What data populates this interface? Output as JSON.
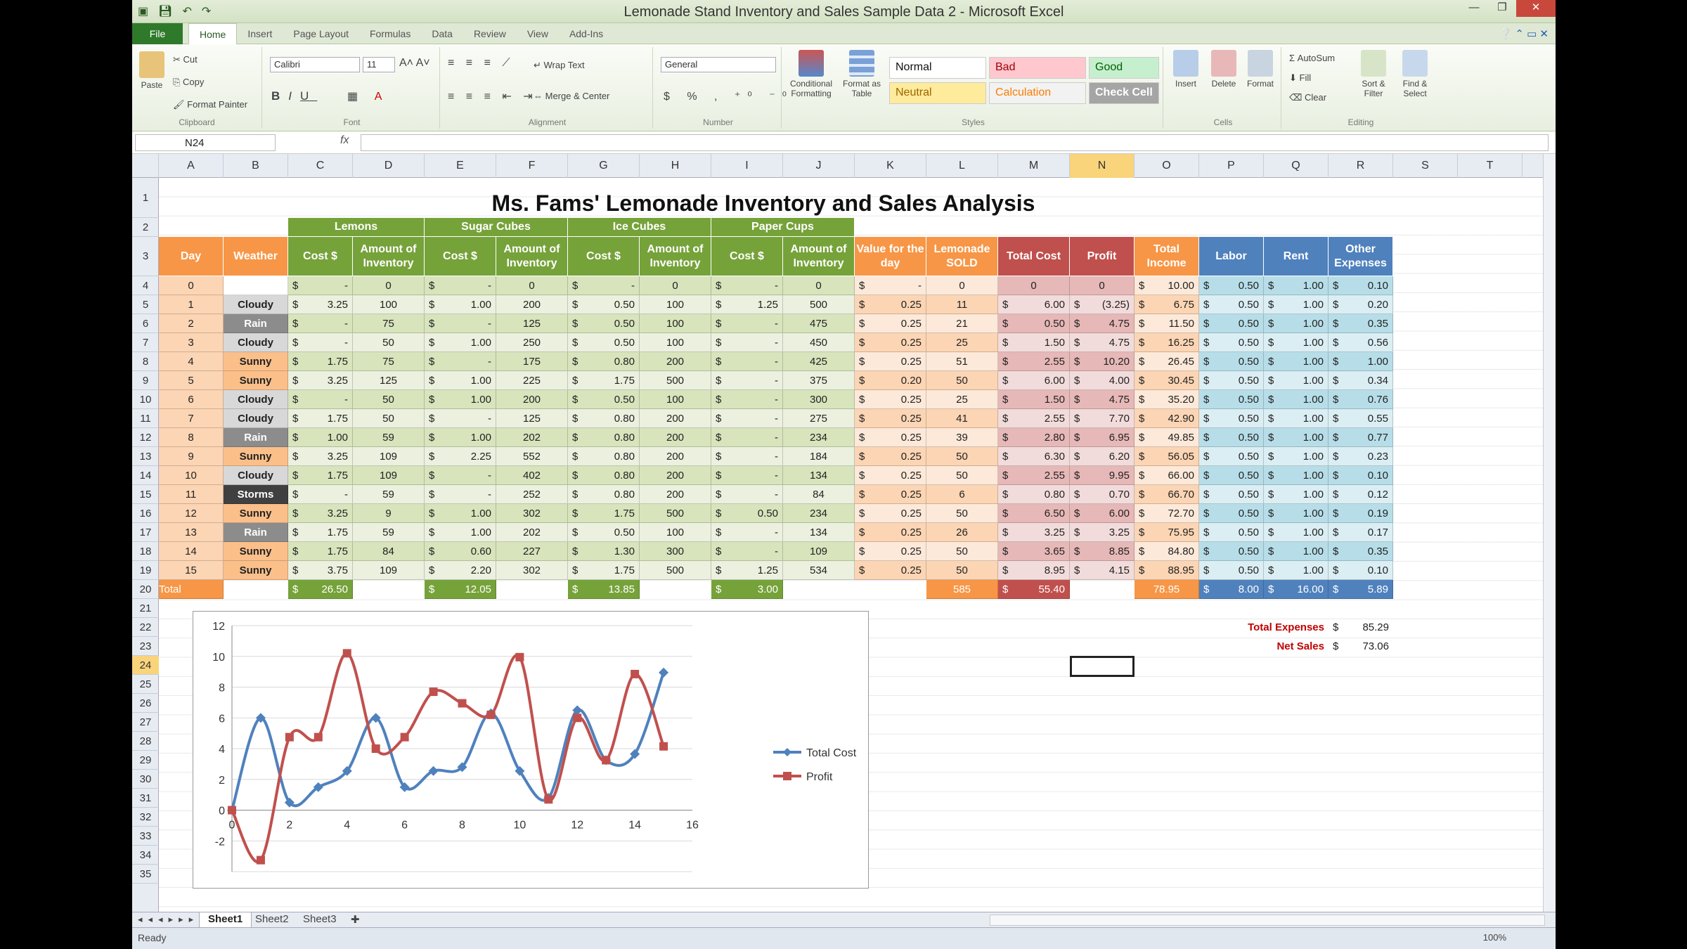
{
  "window": {
    "title": "Lemonade Stand Inventory and Sales Sample Data 2 - Microsoft Excel"
  },
  "tabs": {
    "file": "File",
    "items": [
      "Home",
      "Insert",
      "Page Layout",
      "Formulas",
      "Data",
      "Review",
      "View",
      "Add-Ins"
    ]
  },
  "ribbon": {
    "clipboard": {
      "paste": "Paste",
      "cut": "Cut",
      "copy": "Copy",
      "painter": "Format Painter",
      "label": "Clipboard"
    },
    "font": {
      "name": "Calibri",
      "size": "11",
      "label": "Font"
    },
    "alignment": {
      "wrap": "Wrap Text",
      "merge": "Merge & Center",
      "label": "Alignment"
    },
    "number": {
      "format": "General",
      "label": "Number"
    },
    "styles": {
      "conditional": "Conditional Formatting",
      "table": "Format as Table",
      "normal": "Normal",
      "bad": "Bad",
      "good": "Good",
      "neutral": "Neutral",
      "calculation": "Calculation",
      "check": "Check Cell",
      "label": "Styles"
    },
    "cells": {
      "insert": "Insert",
      "delete": "Delete",
      "format": "Format",
      "label": "Cells"
    },
    "editing": {
      "autosum": "AutoSum",
      "fill": "Fill",
      "clear": "Clear",
      "sort": "Sort & Filter",
      "find": "Find & Select",
      "label": "Editing"
    }
  },
  "formula": {
    "namebox": "N24",
    "fx": "fx"
  },
  "columns": [
    "A",
    "B",
    "C",
    "D",
    "E",
    "F",
    "G",
    "H",
    "I",
    "J",
    "K",
    "L",
    "M",
    "N",
    "O",
    "P",
    "Q",
    "R",
    "S",
    "T",
    "U"
  ],
  "rows": [
    "1",
    "2",
    "3",
    "4",
    "5",
    "6",
    "7",
    "8",
    "9",
    "10",
    "11",
    "12",
    "13",
    "14",
    "15",
    "16",
    "17",
    "18",
    "19",
    "20",
    "21",
    "22",
    "23",
    "24",
    "25",
    "26",
    "27",
    "28",
    "29",
    "30",
    "31",
    "32",
    "33",
    "34",
    "35"
  ],
  "report": {
    "title": "Ms. Fams' Lemonade Inventory and Sales Analysis Report",
    "groups": [
      "Lemons",
      "Sugar Cubes",
      "Ice Cubes",
      "Paper Cups"
    ],
    "headers": [
      "Day",
      "Weather",
      "Cost $",
      "Amount of Inventory",
      "Cost $",
      "Amount of Inventory",
      "Cost $",
      "Amount of Inventory",
      "Cost $",
      "Amount of Inventory",
      "Value for the day",
      "Lemonade SOLD",
      "Total Cost",
      "Profit",
      "Total Income",
      "Labor",
      "Rent",
      "Other Expenses"
    ],
    "rows": [
      [
        "0",
        "",
        "$ -",
        "0",
        "$ -",
        "0",
        "$ -",
        "0",
        "$ -",
        "0",
        "$ -",
        "0",
        "0",
        "0",
        "$ 10.00",
        "$ 0.50",
        "$ 1.00",
        "$ 0.10"
      ],
      [
        "1",
        "Cloudy",
        "$ 3.25",
        "100",
        "$ 1.00",
        "200",
        "$ 0.50",
        "100",
        "$ 1.25",
        "500",
        "$ 0.25",
        "11",
        "$ 6.00",
        "$ (3.25)",
        "$ 6.75",
        "$ 0.50",
        "$ 1.00",
        "$ 0.20"
      ],
      [
        "2",
        "Rain",
        "$ -",
        "75",
        "$ -",
        "125",
        "$ 0.50",
        "100",
        "$ -",
        "475",
        "$ 0.25",
        "21",
        "$ 0.50",
        "$ 4.75",
        "$ 11.50",
        "$ 0.50",
        "$ 1.00",
        "$ 0.35"
      ],
      [
        "3",
        "Cloudy",
        "$ -",
        "50",
        "$ 1.00",
        "250",
        "$ 0.50",
        "100",
        "$ -",
        "450",
        "$ 0.25",
        "25",
        "$ 1.50",
        "$ 4.75",
        "$ 16.25",
        "$ 0.50",
        "$ 1.00",
        "$ 0.56"
      ],
      [
        "4",
        "Sunny",
        "$ 1.75",
        "75",
        "$ -",
        "175",
        "$ 0.80",
        "200",
        "$ -",
        "425",
        "$ 0.25",
        "51",
        "$ 2.55",
        "$ 10.20",
        "$ 26.45",
        "$ 0.50",
        "$ 1.00",
        "$ 1.00"
      ],
      [
        "5",
        "Sunny",
        "$ 3.25",
        "125",
        "$ 1.00",
        "225",
        "$ 1.75",
        "500",
        "$ -",
        "375",
        "$ 0.20",
        "50",
        "$ 6.00",
        "$ 4.00",
        "$ 30.45",
        "$ 0.50",
        "$ 1.00",
        "$ 0.34"
      ],
      [
        "6",
        "Cloudy",
        "$ -",
        "50",
        "$ 1.00",
        "200",
        "$ 0.50",
        "100",
        "$ -",
        "300",
        "$ 0.25",
        "25",
        "$ 1.50",
        "$ 4.75",
        "$ 35.20",
        "$ 0.50",
        "$ 1.00",
        "$ 0.76"
      ],
      [
        "7",
        "Cloudy",
        "$ 1.75",
        "50",
        "$ -",
        "125",
        "$ 0.80",
        "200",
        "$ -",
        "275",
        "$ 0.25",
        "41",
        "$ 2.55",
        "$ 7.70",
        "$ 42.90",
        "$ 0.50",
        "$ 1.00",
        "$ 0.55"
      ],
      [
        "8",
        "Rain",
        "$ 1.00",
        "59",
        "$ 1.00",
        "202",
        "$ 0.80",
        "200",
        "$ -",
        "234",
        "$ 0.25",
        "39",
        "$ 2.80",
        "$ 6.95",
        "$ 49.85",
        "$ 0.50",
        "$ 1.00",
        "$ 0.77"
      ],
      [
        "9",
        "Sunny",
        "$ 3.25",
        "109",
        "$ 2.25",
        "552",
        "$ 0.80",
        "200",
        "$ -",
        "184",
        "$ 0.25",
        "50",
        "$ 6.30",
        "$ 6.20",
        "$ 56.05",
        "$ 0.50",
        "$ 1.00",
        "$ 0.23"
      ],
      [
        "10",
        "Cloudy",
        "$ 1.75",
        "109",
        "$ -",
        "402",
        "$ 0.80",
        "200",
        "$ -",
        "134",
        "$ 0.25",
        "50",
        "$ 2.55",
        "$ 9.95",
        "$ 66.00",
        "$ 0.50",
        "$ 1.00",
        "$ 0.10"
      ],
      [
        "11",
        "Storms",
        "$ -",
        "59",
        "$ -",
        "252",
        "$ 0.80",
        "200",
        "$ -",
        "84",
        "$ 0.25",
        "6",
        "$ 0.80",
        "$ 0.70",
        "$ 66.70",
        "$ 0.50",
        "$ 1.00",
        "$ 0.12"
      ],
      [
        "12",
        "Sunny",
        "$ 3.25",
        "9",
        "$ 1.00",
        "302",
        "$ 1.75",
        "500",
        "$ 0.50",
        "234",
        "$ 0.25",
        "50",
        "$ 6.50",
        "$ 6.00",
        "$ 72.70",
        "$ 0.50",
        "$ 1.00",
        "$ 0.19"
      ],
      [
        "13",
        "Rain",
        "$ 1.75",
        "59",
        "$ 1.00",
        "202",
        "$ 0.50",
        "100",
        "$ -",
        "134",
        "$ 0.25",
        "26",
        "$ 3.25",
        "$ 3.25",
        "$ 75.95",
        "$ 0.50",
        "$ 1.00",
        "$ 0.17"
      ],
      [
        "14",
        "Sunny",
        "$ 1.75",
        "84",
        "$ 0.60",
        "227",
        "$ 1.30",
        "300",
        "$ -",
        "109",
        "$ 0.25",
        "50",
        "$ 3.65",
        "$ 8.85",
        "$ 84.80",
        "$ 0.50",
        "$ 1.00",
        "$ 0.35"
      ],
      [
        "15",
        "Sunny",
        "$ 3.75",
        "109",
        "$ 2.20",
        "302",
        "$ 1.75",
        "500",
        "$ 1.25",
        "534",
        "$ 0.25",
        "50",
        "$ 8.95",
        "$ 4.15",
        "$ 88.95",
        "$ 0.50",
        "$ 1.00",
        "$ 0.10"
      ]
    ],
    "totals": {
      "label": "Total",
      "lemons": "$ 26.50",
      "sugar": "$ 12.05",
      "ice": "$ 13.85",
      "cups": "$ 3.00",
      "sold": "585",
      "cost": "$ 55.40",
      "income": "78.95",
      "labor": "$ 8.00",
      "rent": "$ 16.00",
      "other": "$ 5.89"
    },
    "summary": {
      "expenses_label": "Total Expenses",
      "expenses": "$ 85.29",
      "net_label": "Net Sales",
      "net": "$ 73.06"
    }
  },
  "colors": {
    "green_hdr": "#76a23a",
    "orange_hdr": "#f79646",
    "red_hdr": "#c0504d",
    "blue_hdr": "#4f81bd",
    "sunny": "#fbbf8a",
    "cloudy": "#d8d8d8",
    "rain": "#8c8c8c",
    "storms": "#404040"
  },
  "chart_data": {
    "type": "line",
    "x": [
      0,
      1,
      2,
      3,
      4,
      5,
      6,
      7,
      8,
      9,
      10,
      11,
      12,
      13,
      14,
      15
    ],
    "series": [
      {
        "name": "Total Cost",
        "color": "#4f81bd",
        "values": [
          0,
          6.0,
          0.5,
          1.5,
          2.55,
          6.0,
          1.5,
          2.55,
          2.8,
          6.3,
          2.55,
          0.8,
          6.5,
          3.25,
          3.65,
          8.95
        ]
      },
      {
        "name": "Profit",
        "color": "#c0504d",
        "values": [
          0,
          -3.25,
          4.75,
          4.75,
          10.2,
          4.0,
          4.75,
          7.7,
          6.95,
          6.2,
          9.95,
          0.7,
          6.0,
          3.25,
          8.85,
          4.15
        ]
      }
    ],
    "xlim": [
      0,
      16
    ],
    "ylim": [
      -4,
      12
    ],
    "xticks": [
      "0",
      "2",
      "4",
      "6",
      "8",
      "10",
      "12",
      "14",
      "16"
    ],
    "yticks": [
      "12",
      "10",
      "8",
      "6",
      "4",
      "2",
      "0",
      "-2"
    ],
    "grid": true,
    "legend": "right"
  },
  "sheets": [
    "Sheet1",
    "Sheet2",
    "Sheet3"
  ],
  "status": {
    "ready": "Ready",
    "zoom": "100%"
  }
}
